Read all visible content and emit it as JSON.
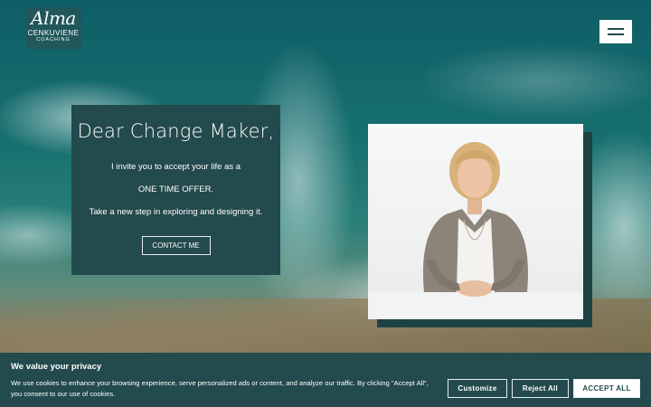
{
  "brand": {
    "logo_script": "Alma",
    "logo_name": "CENKUVIENE",
    "logo_tagline": "COACHING"
  },
  "header": {
    "menu_icon": "hamburger-menu-icon"
  },
  "hero": {
    "heading": "Dear Change Maker,",
    "line1": "I invite you to accept your life as a",
    "line2": "ONE TIME OFFER.",
    "line3": "Take a new step in exploring and designing it.",
    "cta_label": "CONTACT ME"
  },
  "colors": {
    "primary": "#234a4c",
    "accent": "#ffffff"
  },
  "cookie_banner": {
    "title": "We value your privacy",
    "text": "We use cookies to enhance your browsing experience, serve personalized ads or content, and analyze our traffic. By clicking \"Accept All\", you consent to our use of cookies.",
    "customize_label": "Customize",
    "reject_label": "Reject All",
    "accept_label": "ACCEPT ALL"
  }
}
